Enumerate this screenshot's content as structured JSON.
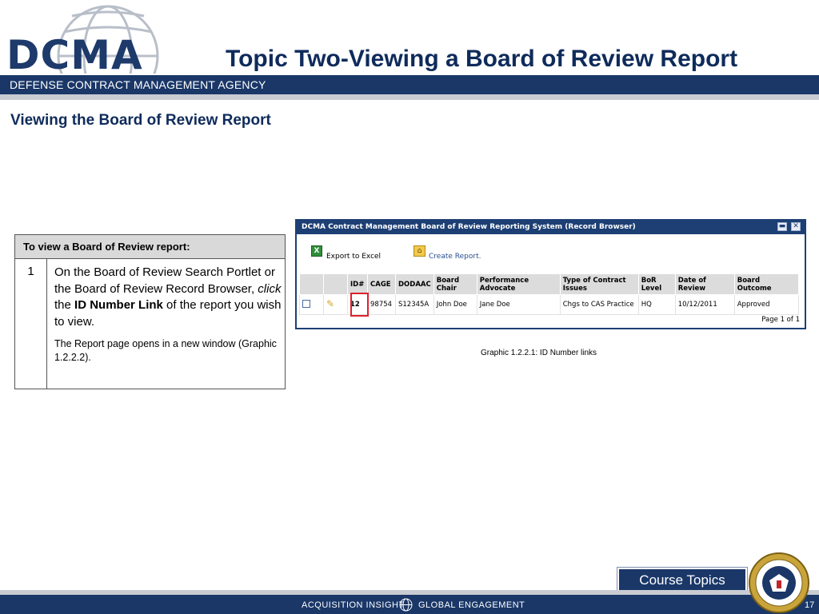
{
  "header": {
    "logo_text": "DCMA",
    "agency_name": "DEFENSE CONTRACT MANAGEMENT AGENCY",
    "page_title": "Topic Two-Viewing a Board of Review Report"
  },
  "section": {
    "heading": "Viewing the Board of Review Report"
  },
  "instructions": {
    "header": "To view a Board of Review report:",
    "step_number": "1",
    "step_text_1": "On the Board of Review Search Portlet or the Board of Review Record Browser, ",
    "step_click": "click",
    "step_text_2": " the ",
    "step_bold": "ID Number Link",
    "step_text_3": " of the report you wish to view.",
    "note": "The Report page opens in a new window (Graphic 1.2.2.2)."
  },
  "screenshot": {
    "window_title": "DCMA Contract Management Board of Review Reporting System (Record Browser)",
    "export_label": "Export to Excel",
    "create_label": "Create Report.",
    "columns": [
      "ID#",
      "CAGE",
      "DODAAC",
      "Board Chair",
      "Performance Advocate",
      "Type of Contract Issues",
      "BoR Level",
      "Date of Review",
      "Board Outcome"
    ],
    "row": {
      "id": "12",
      "cage": "98754",
      "dodaac": "S12345A",
      "board_chair": "John Doe",
      "performance_advocate": "Jane Doe",
      "contract_issue": "Chgs to CAS Practice",
      "bor_level": "HQ",
      "date_of_review": "10/12/2011",
      "board_outcome": "Approved"
    },
    "pager": "Page 1 of 1"
  },
  "caption": "Graphic  1.2.2.1:  ID Number links",
  "footer": {
    "course_topics": "Course Topics",
    "left_text": "ACQUISITION INSIGHT",
    "right_text": "GLOBAL ENGAGEMENT",
    "page_number": "17"
  },
  "colors": {
    "navy": "#1a3768",
    "title_navy": "#0f2b5b",
    "highlight_red": "#e0202a"
  }
}
